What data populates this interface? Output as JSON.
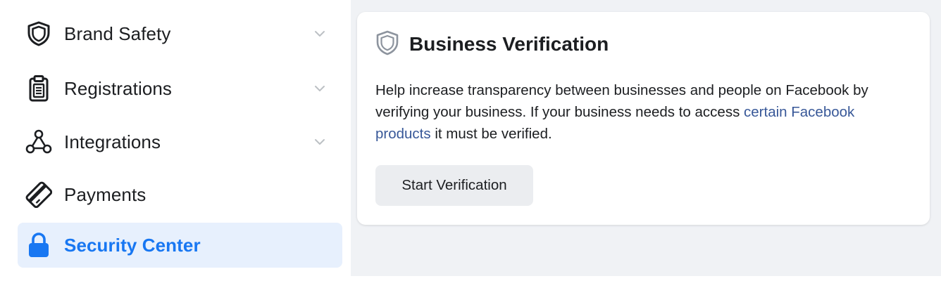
{
  "sidebar": {
    "items": [
      {
        "label": "Brand Safety",
        "icon": "shield-icon",
        "expandable": true,
        "active": false
      },
      {
        "label": "Registrations",
        "icon": "clipboard-icon",
        "expandable": true,
        "active": false
      },
      {
        "label": "Integrations",
        "icon": "integrations-icon",
        "expandable": true,
        "active": false
      },
      {
        "label": "Payments",
        "icon": "credit-card-icon",
        "expandable": false,
        "active": false
      },
      {
        "label": "Security Center",
        "icon": "lock-icon",
        "expandable": false,
        "active": true
      }
    ]
  },
  "card": {
    "icon": "shield-icon",
    "title": "Business Verification",
    "desc_before": "Help increase transparency between businesses and people on Facebook by verifying your business. If your business needs to access ",
    "desc_link": "certain Facebook products",
    "desc_after": " it must be verified.",
    "button_label": "Start Verification"
  },
  "colors": {
    "accent": "#1877f2",
    "active_bg": "#e7f0fd",
    "link": "#385898",
    "page_bg": "#f0f2f5",
    "button_bg": "#ebedf0"
  }
}
